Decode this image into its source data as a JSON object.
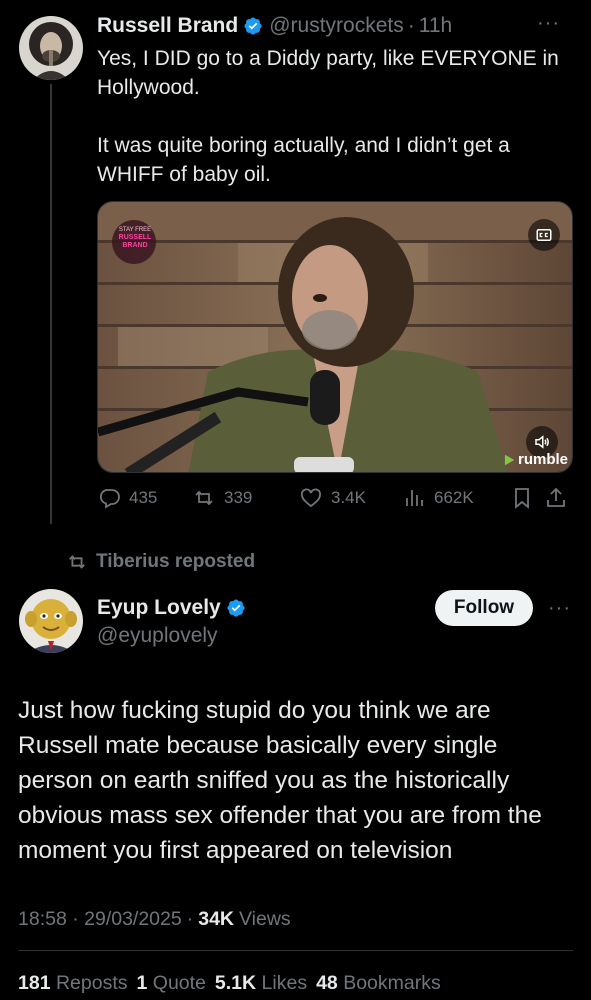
{
  "first_tweet": {
    "author_name": "Russell Brand",
    "handle": "@rustyrockets",
    "time": "11h",
    "text": "Yes, I DID go to a Diddy party, like EVERYONE in Hollywood.\n\nIt was quite boring actually, and I didn’t get a WHIFF of baby oil.",
    "media": {
      "logo_text_top": "STAY FREE",
      "logo_text_main": "RUSSELL BRAND",
      "provider": "rumble"
    },
    "actions": {
      "replies": "435",
      "reposts": "339",
      "likes": "3.4K",
      "views": "662K"
    }
  },
  "repost_banner": {
    "text": "Tiberius reposted"
  },
  "main_tweet": {
    "author_name": "Eyup Lovely",
    "handle": "@eyuplovely",
    "follow_label": "Follow",
    "text": "Just how fucking stupid do you think we are Russell mate because basically every single person on earth sniffed you as the historically obvious mass sex offender that you are from the moment you first appeared on television",
    "timestamp": "18:58 · 29/03/2025",
    "views_count": "34K",
    "views_label": "Views",
    "stats": {
      "reposts_count": "181",
      "reposts_label": "Reposts",
      "quotes_count": "1",
      "quotes_label": "Quote",
      "likes_count": "5.1K",
      "likes_label": "Likes",
      "bookmarks_count": "48",
      "bookmarks_label": "Bookmarks"
    }
  },
  "colors": {
    "background": "#000000",
    "text": "#e7e9ea",
    "muted": "#71767b",
    "verified": "#1d9bf0",
    "rumble": "#85c742"
  }
}
